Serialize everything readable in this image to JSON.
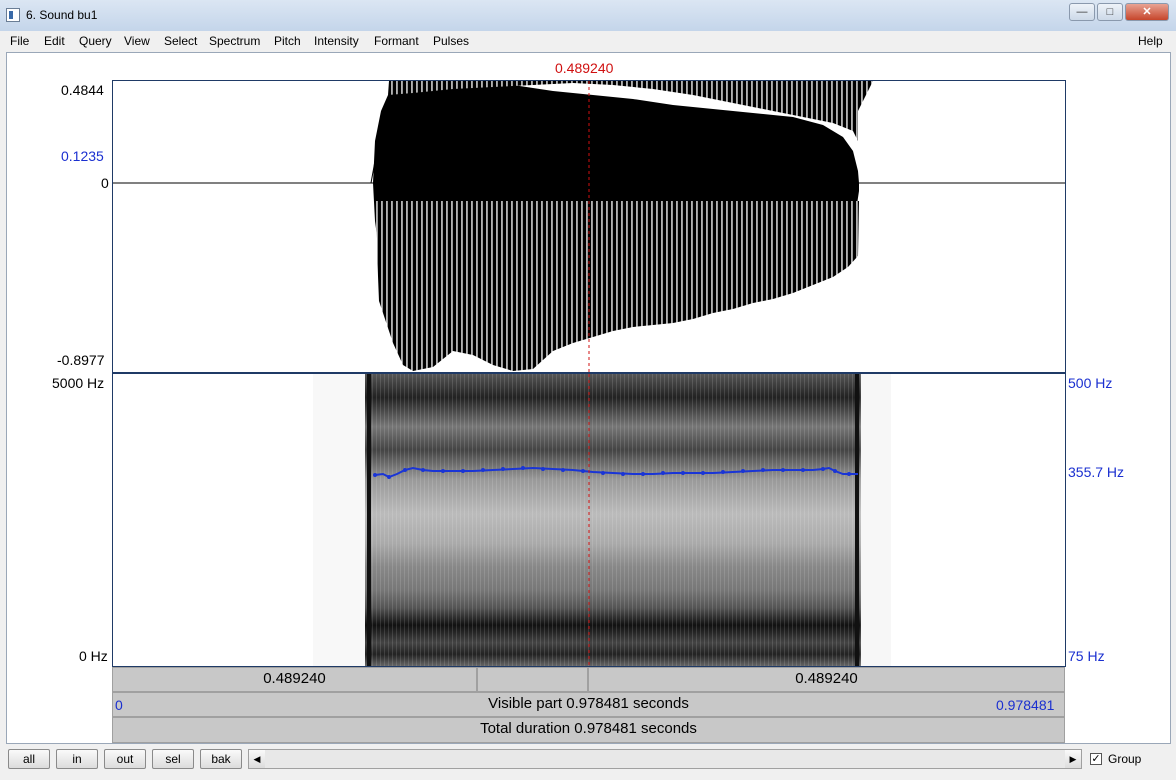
{
  "window": {
    "title": "6. Sound bu1"
  },
  "menu": [
    "File",
    "Edit",
    "Query",
    "View",
    "Select",
    "Spectrum",
    "Pitch",
    "Intensity",
    "Formant",
    "Pulses"
  ],
  "help": "Help",
  "cursor_time": "0.489240",
  "waveform": {
    "ymax": "0.4844",
    "ymid_blue": "0.1235",
    "zero": "0",
    "ymin": "-0.8977"
  },
  "spectrogram": {
    "top_freq": "5000 Hz",
    "bottom_freq": "0 Hz",
    "pitch_top": "500 Hz",
    "pitch_value": "355.7 Hz",
    "pitch_bottom": "75 Hz"
  },
  "time_bar": {
    "left_segment": "0.489240",
    "right_segment": "0.489240"
  },
  "visible_bar": {
    "start": "0",
    "label": "Visible part 0.978481 seconds",
    "end": "0.978481"
  },
  "total_bar": {
    "label": "Total duration 0.978481 seconds"
  },
  "buttons": [
    "all",
    "in",
    "out",
    "sel",
    "bak"
  ],
  "group_label": "Group",
  "colors": {
    "waveform": "#000000",
    "pitch": "#1a35d6",
    "cursor": "#d01010",
    "axis_blue": "#1a2fd0"
  }
}
